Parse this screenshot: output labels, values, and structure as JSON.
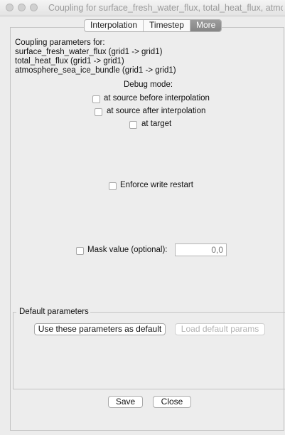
{
  "window": {
    "title": "Coupling for surface_fresh_water_flux, total_heat_flux, atmosphere_..."
  },
  "tabs": [
    {
      "label": "Interpolation",
      "active": false
    },
    {
      "label": "Timestep",
      "active": false
    },
    {
      "label": "More",
      "active": true
    }
  ],
  "coupling": {
    "heading": "Coupling parameters for:",
    "lines": [
      "surface_fresh_water_flux (grid1 -> grid1)",
      "total_heat_flux (grid1 -> grid1)",
      "atmosphere_sea_ice_bundle (grid1 -> grid1)"
    ]
  },
  "debug": {
    "title": "Debug mode:",
    "options": [
      {
        "label": "at source before interpolation",
        "checked": false
      },
      {
        "label": "at source after interpolation",
        "checked": false
      },
      {
        "label": "at target",
        "checked": false
      }
    ]
  },
  "enforce_restart": {
    "label": "Enforce write restart",
    "checked": false
  },
  "mask": {
    "label": "Mask value (optional):",
    "checked": false,
    "value": "0,0"
  },
  "defaults": {
    "group_label": "Default parameters",
    "use_button": "Use these parameters as default",
    "load_button": "Load default params"
  },
  "footer": {
    "save": "Save",
    "close": "Close"
  }
}
